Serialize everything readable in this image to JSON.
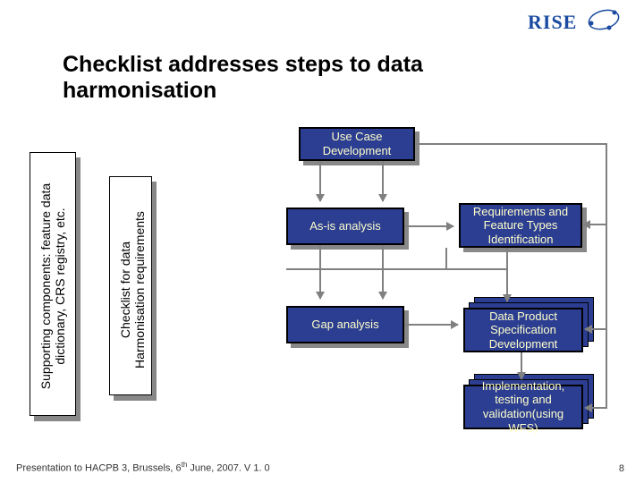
{
  "logo": {
    "text": "RISE"
  },
  "title": "Checklist addresses steps to data harmonisation",
  "vbar1": {
    "line1": "Supporting components: feature data",
    "line2": "dictionary, CRS registry, etc."
  },
  "vbar2": {
    "line1": "Checklist for data",
    "line2": "Harmonisation requirements"
  },
  "boxes": {
    "usecase": "Use Case Development",
    "asis": "As-is analysis",
    "req": "Requirements and Feature Types Identification",
    "gap": "Gap analysis",
    "dps": "Data Product Specification Development",
    "impl": "Implementation, testing and validation(using WFS)"
  },
  "footer": {
    "left_pre": "Presentation to HACPB 3, Brussels, 6",
    "left_sup": "th",
    "left_post": " June, 2007. V 1. 0",
    "page": "8"
  }
}
